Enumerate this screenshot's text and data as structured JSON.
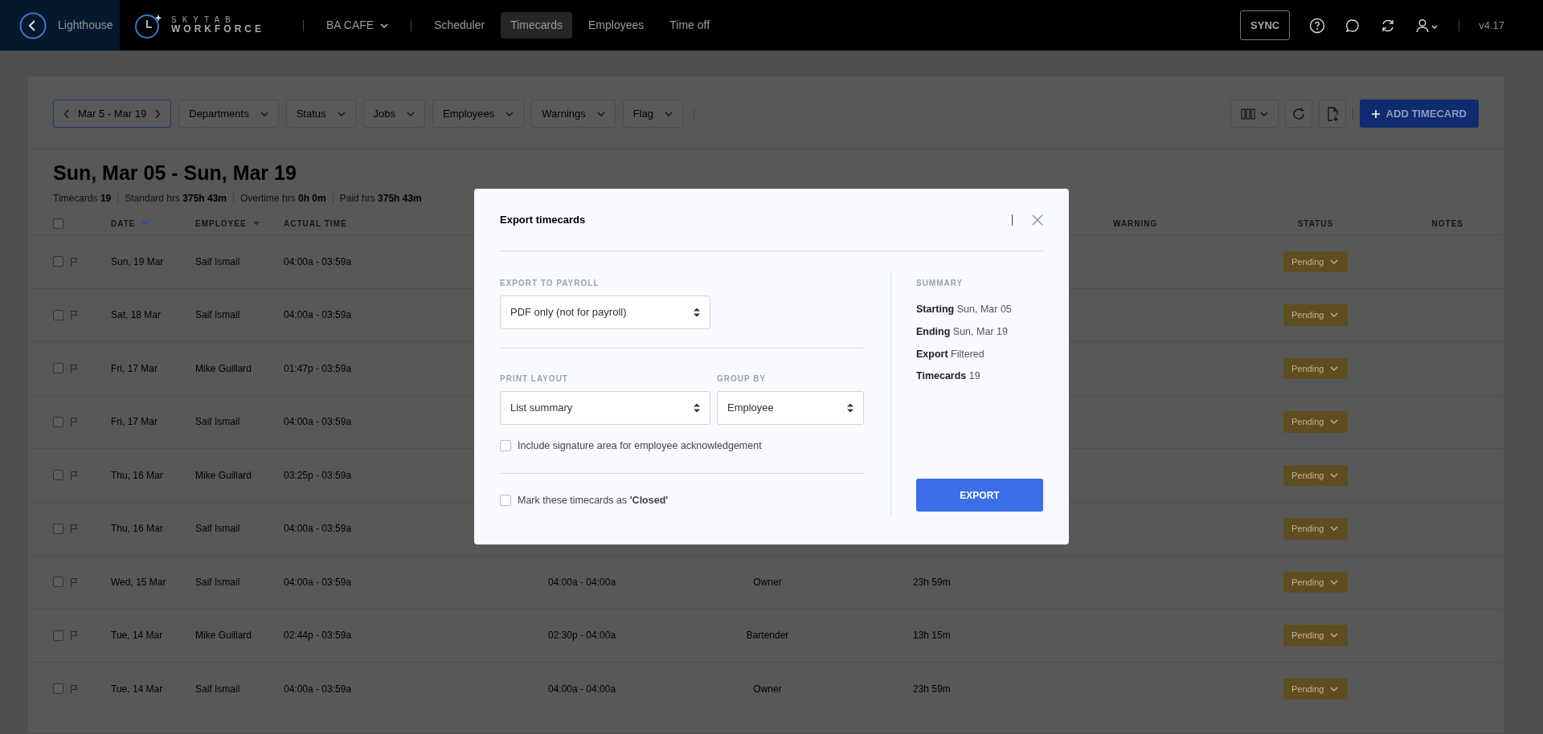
{
  "top_bar": {
    "back_label": "Lighthouse",
    "logo": {
      "line_1": "SKYTAB",
      "line_2": "WORKFORCE"
    },
    "location": "BA CAFE",
    "nav": [
      {
        "label": "Scheduler",
        "selected": false
      },
      {
        "label": "Timecards",
        "selected": true
      },
      {
        "label": "Employees",
        "selected": false
      },
      {
        "label": "Time off",
        "selected": false
      }
    ],
    "sync": "SYNC",
    "version": "v4.17"
  },
  "filters": {
    "date_range": "Mar 5 - Mar 19",
    "dropdowns": [
      "Departments",
      "Status",
      "Jobs",
      "Employees",
      "Warnings",
      "Flag"
    ],
    "add_button": "ADD TIMECARD"
  },
  "period": {
    "title": "Sun, Mar 05 - Sun, Mar 19",
    "stats": [
      {
        "label": "Timecards",
        "value": "19"
      },
      {
        "label": "Standard hrs",
        "value": "375h 43m"
      },
      {
        "label": "Overtime hrs",
        "value": "0h 0m"
      },
      {
        "label": "Paid hrs",
        "value": "375h 43m"
      }
    ]
  },
  "table": {
    "all_checked": false,
    "columns": [
      {
        "label": "DATE",
        "sorted": true
      },
      {
        "label": "EMPLOYEE",
        "sorted": false
      },
      {
        "label": "ACTUAL TIME"
      },
      {
        "label": "WARNING"
      },
      {
        "label": "STATUS"
      },
      {
        "label": "NOTES"
      }
    ],
    "rows": [
      {
        "checked": false,
        "date": "Sun, 19 Mar",
        "employee": "Saif Ismail",
        "actual_time": "04:00a - 03:59a",
        "status": "Pending"
      },
      {
        "checked": false,
        "date": "Sat, 18 Mar",
        "employee": "Saif Ismail",
        "actual_time": "04:00a - 03:59a",
        "status": "Pending"
      },
      {
        "checked": false,
        "date": "Fri, 17 Mar",
        "employee": "Mike Guillard",
        "actual_time": "01:47p - 03:59a",
        "status": "Pending"
      },
      {
        "checked": false,
        "date": "Fri, 17 Mar",
        "employee": "Saif Ismail",
        "actual_time": "04:00a - 03:59a",
        "status": "Pending"
      },
      {
        "checked": false,
        "date": "Thu, 16 Mar",
        "employee": "Mike Guillard",
        "actual_time": "03:25p - 03:59a",
        "status": "Pending"
      },
      {
        "checked": false,
        "date": "Thu, 16 Mar",
        "employee": "Saif Ismail",
        "actual_time": "04:00a - 03:59a",
        "status": "Pending"
      },
      {
        "checked": false,
        "date": "Wed, 15 Mar",
        "employee": "Saif Ismail",
        "actual_time": "04:00a - 03:59a",
        "scheduled_time": "04:00a - 04:00a",
        "job": "Owner",
        "hours": "23h 59m",
        "status": "Pending"
      },
      {
        "checked": false,
        "date": "Tue, 14 Mar",
        "employee": "Mike Guillard",
        "actual_time": "02:44p - 03:59a",
        "scheduled_time": "02:30p - 04:00a",
        "job": "Bartender",
        "hours": "13h 15m",
        "status": "Pending"
      },
      {
        "checked": false,
        "date": "Tue, 14 Mar",
        "employee": "Saif Ismail",
        "actual_time": "04:00a - 03:59a",
        "scheduled_time": "04:00a - 04:00a",
        "job": "Owner",
        "hours": "23h 59m",
        "status": "Pending"
      }
    ]
  },
  "modal": {
    "title": "Export timecards",
    "payroll": {
      "label": "EXPORT TO PAYROLL",
      "value": "PDF only (not for payroll)"
    },
    "print_layout": {
      "label": "PRINT LAYOUT",
      "value": "List summary"
    },
    "group_by": {
      "label": "GROUP BY",
      "value": "Employee"
    },
    "signature": {
      "label": "Include signature area for employee acknowledgement",
      "checked": false
    },
    "mark_closed": {
      "label": "Mark these timecards as **'Closed'**",
      "checked": false
    },
    "summary": {
      "heading": "SUMMARY",
      "items": [
        {
          "label": "Starting",
          "value": "Sun, Mar 05"
        },
        {
          "label": "Ending",
          "value": "Sun, Mar 19"
        },
        {
          "label": "Export",
          "value": "Filtered"
        },
        {
          "label": "Timecards",
          "value": "19"
        }
      ]
    },
    "export_button": "EXPORT"
  }
}
